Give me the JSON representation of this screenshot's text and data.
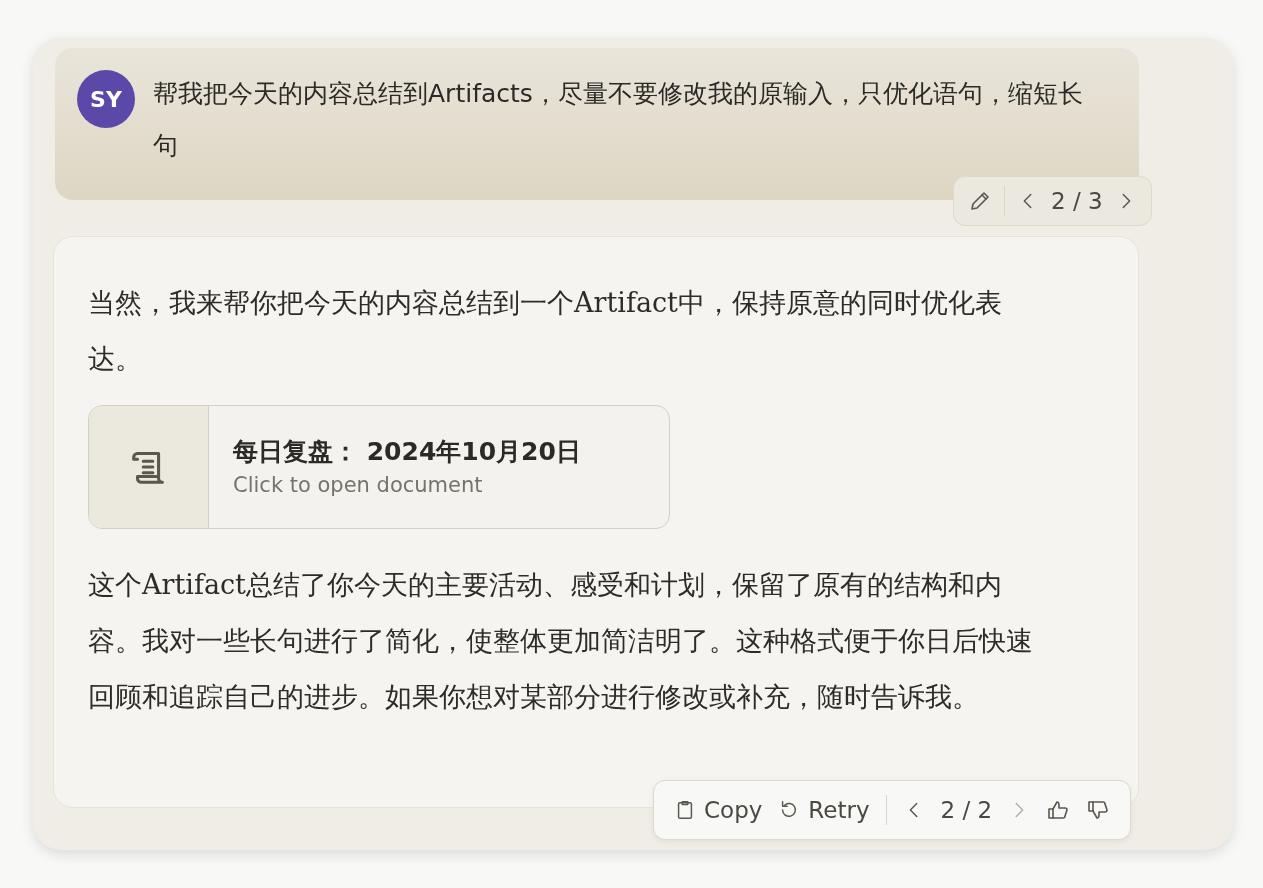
{
  "user_message": {
    "avatar": "SY",
    "text": "帮我把今天的内容总结到Artifacts，尽量不要修改我的原输入，只优化语句，缩短长句",
    "pager": {
      "reading": "2 / 3",
      "prev_disabled": false,
      "next_disabled": false
    }
  },
  "response": {
    "paragraphs": [
      "当然，我来帮你把今天的内容总结到一个Artifact中，保持原意的同时优化表达。",
      "这个Artifact总结了你今天的主要活动、感受和计划，保留了原有的结构和内容。我对一些长句进行了简化，使整体更加简洁明了。这种格式便于你日后快速回顾和追踪自己的进步。如果你想对某部分进行修改或补充，随时告诉我。"
    ],
    "artifact": {
      "title": "每日复盘： 2024年10月20日",
      "subtitle": "Click to open document"
    },
    "actions": {
      "copy": "Copy",
      "retry": "Retry",
      "pager": {
        "reading": "2 / 2",
        "prev_disabled": false,
        "next_disabled": true
      }
    }
  }
}
